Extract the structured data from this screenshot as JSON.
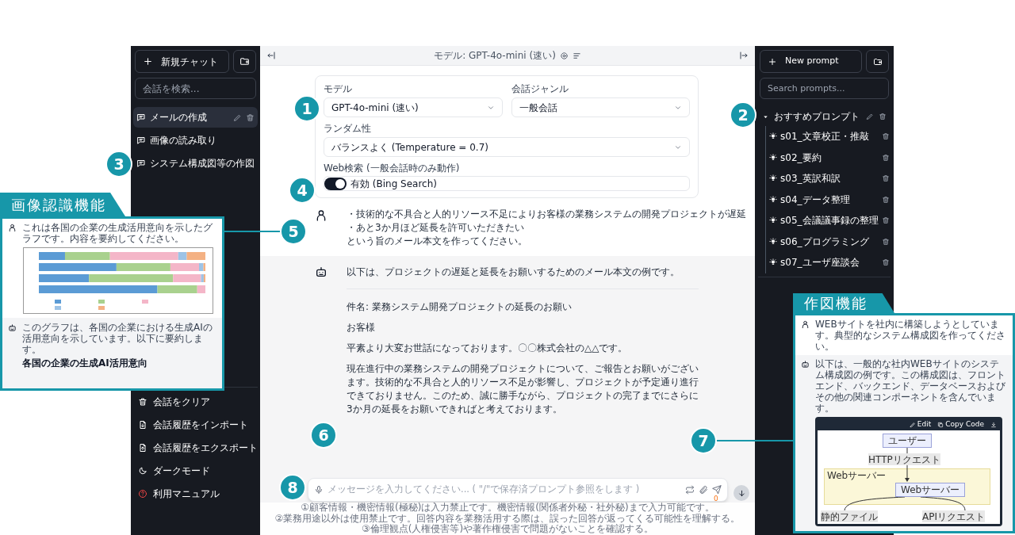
{
  "left_sidebar": {
    "new_chat_label": "新規チャット",
    "search_placeholder": "会話を検索...",
    "conversations": [
      {
        "title": "メールの作成",
        "selected": true
      },
      {
        "title": "画像の読み取り",
        "selected": false
      },
      {
        "title": "システム構成図等の作図",
        "selected": false
      }
    ],
    "footer_items": [
      {
        "label": "会話をクリア",
        "kind": "clear"
      },
      {
        "label": "会話履歴をインポート",
        "kind": "import"
      },
      {
        "label": "会話履歴をエクスポート",
        "kind": "export"
      },
      {
        "label": "ダークモード",
        "kind": "theme"
      },
      {
        "label": "利用マニュアル",
        "kind": "manual"
      }
    ]
  },
  "header": {
    "title": "モデル: GPT-4o-mini (速い)"
  },
  "settings": {
    "model": {
      "label": "モデル",
      "value": "GPT-4o-mini (速い)"
    },
    "genre": {
      "label": "会話ジャンル",
      "value": "一般会話"
    },
    "randomness": {
      "label": "ランダム性",
      "value": "バランスよく (Temperature = 0.7)"
    },
    "web_search": {
      "label": "Web検索 (一般会話時のみ動作)",
      "on": true,
      "value": "有効 (Bing Search)"
    }
  },
  "messages": [
    {
      "kind": "user",
      "lines": [
        "・技術的な不具合と人的リソース不足によりお客様の業務システムの開発プロジェクトが遅延",
        "・あと3か月ほど延長を許可いただきたい",
        "という旨のメール本文を作ってください。"
      ]
    },
    {
      "kind": "assistant",
      "intro": "以下は、プロジェクトの遅延と延長をお願いするためのメール本文の例です。",
      "paragraphs": [
        "件名: 業務システム開発プロジェクトの延長のお願い",
        "お客様",
        "平素より大変お世話になっております。〇〇株式会社の△△です。",
        "現在進行中の業務システムの開発プロジェクトについて、ご報告とお願いがございます。技術的な不具合と人的リソース不足が影響し、プロジェクトが予定通り進行できておりません。このため、誠に勝手ながら、プロジェクトの完了までにさらに3か月の延長をお願いできればと考えております。"
      ]
    }
  ],
  "composer": {
    "placeholder": "メッセージを入力してください... ( \"/\"で保存済プロンプト参照をします )",
    "counter": "0"
  },
  "notes": [
    "①顧客情報・機密情報(極秘)は入力禁止です。機密情報(関係者外秘・社外秘)まで入力可能です。",
    "②業務用途以外は使用禁止です。回答内容を業務活用する際は、誤った回答が返ってくる可能性を理解する。",
    "③倫理観点(人権侵害等)や著作権侵害で問題がないことを確認する。"
  ],
  "right_sidebar": {
    "new_prompt_label": "New prompt",
    "search_placeholder": "Search prompts...",
    "folder": {
      "name": "おすすめプロンプト",
      "expanded": true,
      "prompts": [
        "s01_文章校正・推敲",
        "s02_要約",
        "s03_英訳和訳",
        "s04_データ整理",
        "s05_会議議事録の整理",
        "s06_プログラミング",
        "s07_ユーザ座談会"
      ]
    }
  },
  "callouts": [
    "1",
    "2",
    "3",
    "4",
    "5",
    "6",
    "7",
    "8"
  ],
  "feature_insets": [
    {
      "kind": "chart",
      "title": "画像認識機能",
      "user_text": "これは各国の企業の生成活用意向を示したグラフです。内容を要約してください。",
      "assistant_text": "このグラフは、各国の企業における生成AIの活用意向を示しています。以下に要約します。",
      "assistant_heading": "各国の企業の生成AI活用意向"
    },
    {
      "kind": "diagram",
      "title": "作図機能",
      "user_text": "WEBサイトを社内に構築しようとしています。典型的なシステム構成図を作ってください。",
      "assistant_text": "以下は、一般的な社内WEBサイトのシステム構成図の例です。この構成図は、フロントエンド、バックエンド、データベースおよびその他の関連コンポーネントを含んでいます。",
      "code_toolbar": [
        {
          "label": "Edit",
          "kind": "edit"
        },
        {
          "label": "Copy Code",
          "kind": "copy"
        }
      ],
      "diagram": {
        "top_node": "ユーザー",
        "request_label": "HTTPリクエスト",
        "group_label": "Webサーバー",
        "server_node": "Webサーバー",
        "left_label": "静的ファイル",
        "right_label": "APIリクエスト"
      }
    }
  ]
}
